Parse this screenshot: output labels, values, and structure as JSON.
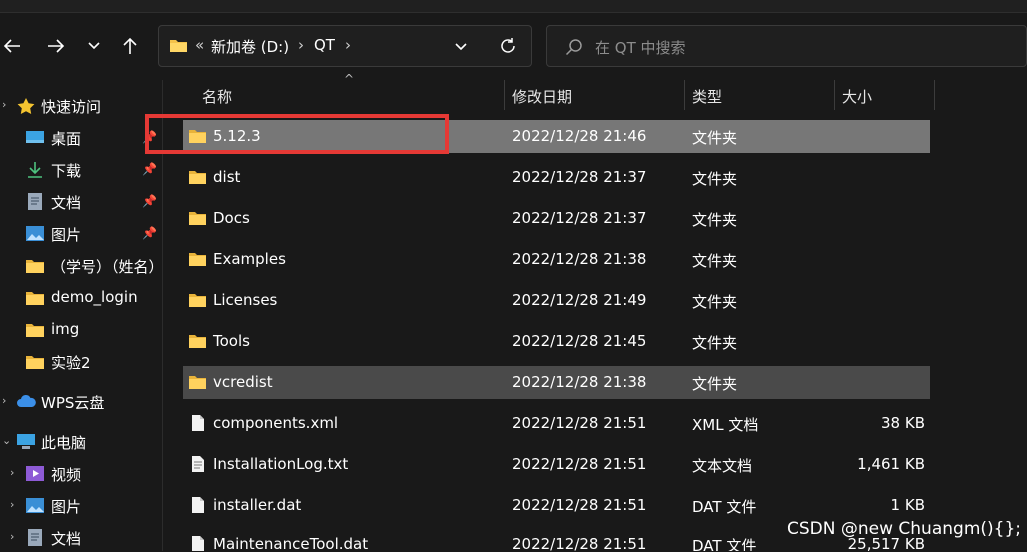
{
  "nav": {
    "back_icon": "arrow-left-icon",
    "forward_icon": "arrow-right-icon",
    "recent_icon": "chevron-down-icon",
    "up_icon": "arrow-up-icon"
  },
  "address_bar": {
    "overflow": "«",
    "segments": [
      "新加卷 (D:)",
      "QT"
    ],
    "separator": "›"
  },
  "search": {
    "placeholder": "在 QT 中搜索"
  },
  "sidebar": {
    "quick_access": "快速访问",
    "items": [
      {
        "label": "桌面",
        "icon": "desktop-icon",
        "pinned": true
      },
      {
        "label": "下载",
        "icon": "download-icon",
        "pinned": true
      },
      {
        "label": "文档",
        "icon": "document-icon",
        "pinned": true
      },
      {
        "label": "图片",
        "icon": "picture-icon",
        "pinned": true
      },
      {
        "label": "（学号）（姓名）",
        "icon": "folder-icon",
        "pinned": false
      },
      {
        "label": "demo_login",
        "icon": "folder-icon",
        "pinned": false
      },
      {
        "label": "img",
        "icon": "folder-icon",
        "pinned": false
      },
      {
        "label": "实验2",
        "icon": "folder-icon",
        "pinned": false
      }
    ],
    "wps": "WPS云盘",
    "this_pc": "此电脑",
    "pc_items": [
      {
        "label": "视频",
        "icon": "video-icon"
      },
      {
        "label": "图片",
        "icon": "picture-icon"
      },
      {
        "label": "文档",
        "icon": "document-icon"
      }
    ]
  },
  "columns": {
    "name": "名称",
    "date": "修改日期",
    "type": "类型",
    "size": "大小"
  },
  "files": [
    {
      "name": "5.12.3",
      "date": "2022/12/28 21:46",
      "type": "文件夹",
      "size": "",
      "kind": "folder",
      "state": "selected"
    },
    {
      "name": "dist",
      "date": "2022/12/28 21:37",
      "type": "文件夹",
      "size": "",
      "kind": "folder",
      "state": ""
    },
    {
      "name": "Docs",
      "date": "2022/12/28 21:37",
      "type": "文件夹",
      "size": "",
      "kind": "folder",
      "state": ""
    },
    {
      "name": "Examples",
      "date": "2022/12/28 21:38",
      "type": "文件夹",
      "size": "",
      "kind": "folder",
      "state": ""
    },
    {
      "name": "Licenses",
      "date": "2022/12/28 21:49",
      "type": "文件夹",
      "size": "",
      "kind": "folder",
      "state": ""
    },
    {
      "name": "Tools",
      "date": "2022/12/28 21:45",
      "type": "文件夹",
      "size": "",
      "kind": "folder",
      "state": ""
    },
    {
      "name": "vcredist",
      "date": "2022/12/28 21:38",
      "type": "文件夹",
      "size": "",
      "kind": "folder",
      "state": "hover"
    },
    {
      "name": "components.xml",
      "date": "2022/12/28 21:51",
      "type": "XML 文档",
      "size": "38 KB",
      "kind": "file",
      "state": ""
    },
    {
      "name": "InstallationLog.txt",
      "date": "2022/12/28 21:51",
      "type": "文本文档",
      "size": "1,461 KB",
      "kind": "file",
      "state": ""
    },
    {
      "name": "installer.dat",
      "date": "2022/12/28 21:51",
      "type": "DAT 文件",
      "size": "1 KB",
      "kind": "file",
      "state": ""
    },
    {
      "name": "MaintenanceTool.dat",
      "date": "2022/12/28 21:51",
      "type": "DAT 文件",
      "size": "25,517 KB",
      "kind": "file",
      "state": ""
    }
  ],
  "watermark": "CSDN @new Chuangm(){};",
  "colors": {
    "background": "#191919",
    "selected": "#777777",
    "hover": "#4a4a4a",
    "folder": "#f4c24a",
    "annotation": "#e53935"
  }
}
